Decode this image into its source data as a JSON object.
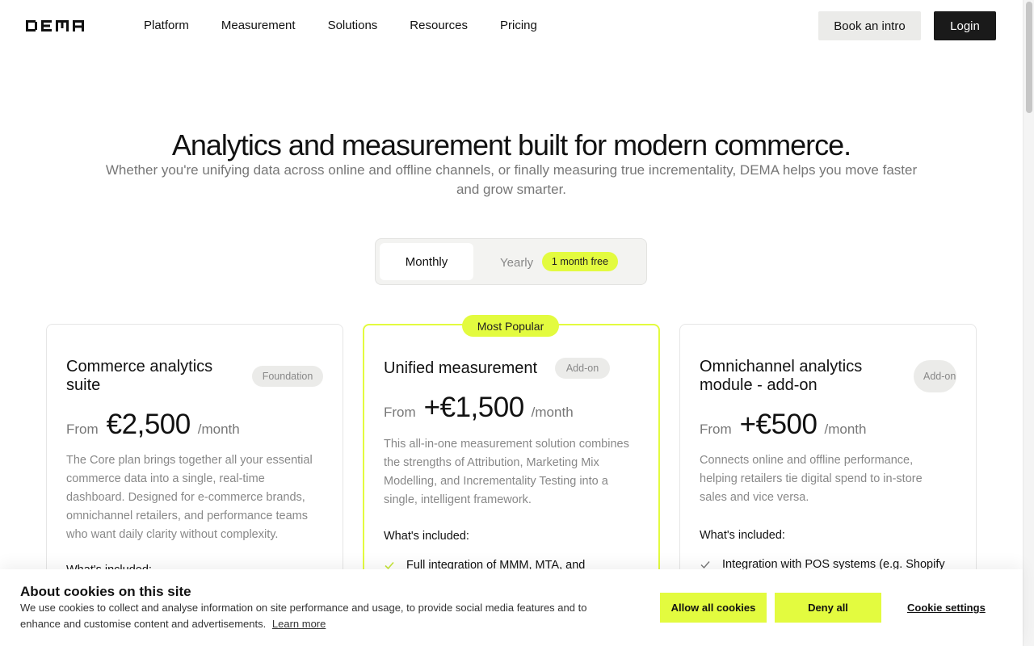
{
  "brand": {
    "logo_text": "DEMA",
    "accent": "#e3fb3f"
  },
  "nav": {
    "items": [
      {
        "label": "Platform"
      },
      {
        "label": "Measurement"
      },
      {
        "label": "Solutions"
      },
      {
        "label": "Resources"
      },
      {
        "label": "Pricing"
      }
    ],
    "book_label": "Book an intro",
    "login_label": "Login"
  },
  "hero": {
    "title": "Analytics and measurement built for modern commerce.",
    "subtitle": "Whether you're unifying data across online and offline channels, or finally measuring true incrementality, DEMA helps you move faster and grow smarter."
  },
  "billing_toggle": {
    "monthly": "Monthly",
    "yearly": "Yearly",
    "yearly_badge": "1 month free",
    "selected": "Monthly"
  },
  "plans": [
    {
      "title": "Commerce analytics suite",
      "badge": "Foundation",
      "from": "From",
      "price": "€2,500",
      "per": "/month",
      "description": "The Core plan brings together all your essential commerce data into a single, real-time dashboard. Designed for e-commerce brands, omnichannel retailers, and performance teams who want daily clarity without complexity.",
      "included_label": "What's included:",
      "features": []
    },
    {
      "title": "Unified measurement",
      "badge": "Add-on",
      "popular": "Most Popular",
      "from": "From",
      "price": "+€1,500",
      "per": "/month",
      "description": "This all-in-one measurement solution combines the strengths of Attribution, Marketing Mix Modelling, and Incrementality Testing into a single, intelligent framework.",
      "included_label": "What's included:",
      "features": [
        "Full integration of MMM, MTA, and"
      ]
    },
    {
      "title": "Omnichannel analytics module - add-on",
      "badge": "Add-on",
      "from": "From",
      "price": "+€500",
      "per": "/month",
      "description": "Connects online and offline performance, helping retailers tie digital spend to in-store sales and vice versa.",
      "included_label": "What's included:",
      "features": [
        "Integration with POS systems (e.g. Shopify"
      ]
    }
  ],
  "cookie": {
    "title": "About cookies on this site",
    "text": "We use cookies to collect and analyse information on site performance and usage, to provide social media features and to enhance and customise content and advertisements.",
    "learn_more": "Learn more",
    "allow_label": "Allow all cookies",
    "deny_label": "Deny all",
    "settings_label": "Cookie settings"
  }
}
